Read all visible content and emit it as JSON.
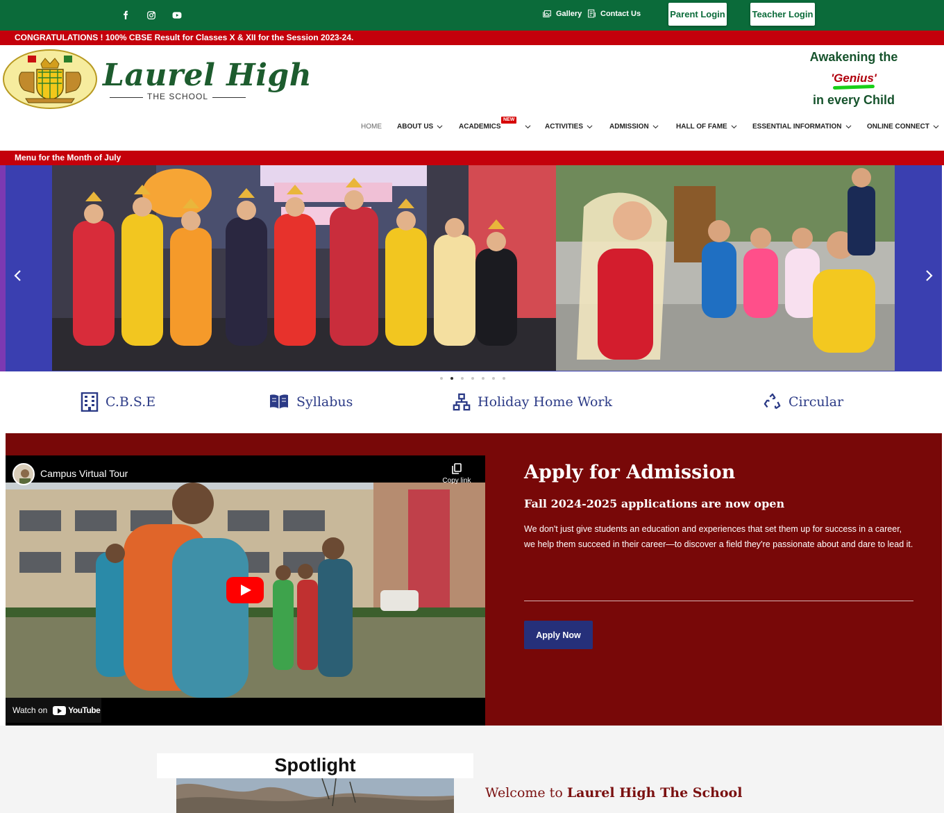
{
  "topbar": {
    "social": [
      "facebook-icon",
      "instagram-icon",
      "youtube-icon"
    ],
    "gallery_label": "Gallery",
    "contact_label": "Contact Us",
    "parent_login": "Parent Login",
    "teacher_login": "Teacher Login"
  },
  "ticker": {
    "top": "CONGRATULATIONS ! 100% CBSE Result for Classes X & XII for the Session 2023-24.",
    "menu": "Menu for the Month of July"
  },
  "header": {
    "logo_title": "Laurel High",
    "logo_sub": "THE SCHOOL",
    "tag_line1": "Awakening the",
    "tag_line2": "'Genius'",
    "tag_line3": "in every Child"
  },
  "nav": {
    "items": [
      {
        "label": "HOME"
      },
      {
        "label": "ABOUT US"
      },
      {
        "label": "ACADEMICS",
        "badge": "NEW"
      },
      {
        "label": "ACTIVITIES"
      },
      {
        "label": "ADMISSION"
      },
      {
        "label": "HALL OF FAME"
      },
      {
        "label": "ESSENTIAL INFORMATION"
      },
      {
        "label": "ONLINE CONNECT"
      }
    ]
  },
  "slider": {
    "slide_count": 7,
    "active_index": 1
  },
  "quick_links": [
    {
      "label": "C.B.S.E",
      "icon": "building-icon"
    },
    {
      "label": "Syllabus",
      "icon": "book-icon"
    },
    {
      "label": "Holiday Home Work",
      "icon": "sitemap-icon"
    },
    {
      "label": "Circular",
      "icon": "recycle-icon"
    }
  ],
  "video": {
    "title": "Campus Virtual Tour",
    "copy_link": "Copy link",
    "watch_on": "Watch on",
    "youtube": "YouTube"
  },
  "admission": {
    "title": "Apply for Admission",
    "subtitle": "Fall 2024-2025 applications are now open",
    "text": "We don't just give students an education and experiences that set them up for success in a career, we help them succeed in their career—to discover a field they're passionate about and dare to lead it.",
    "button": "Apply Now"
  },
  "bottom": {
    "spotlight": "Spotlight",
    "welcome_prefix": "Welcome to",
    "welcome_name": "Laurel High The School"
  },
  "colors": {
    "top_green": "#0b6b3a",
    "ticker_red": "#c4000b",
    "admission_maroon": "#780808",
    "link_blue": "#2b3a86",
    "button_blue": "#26307a"
  }
}
